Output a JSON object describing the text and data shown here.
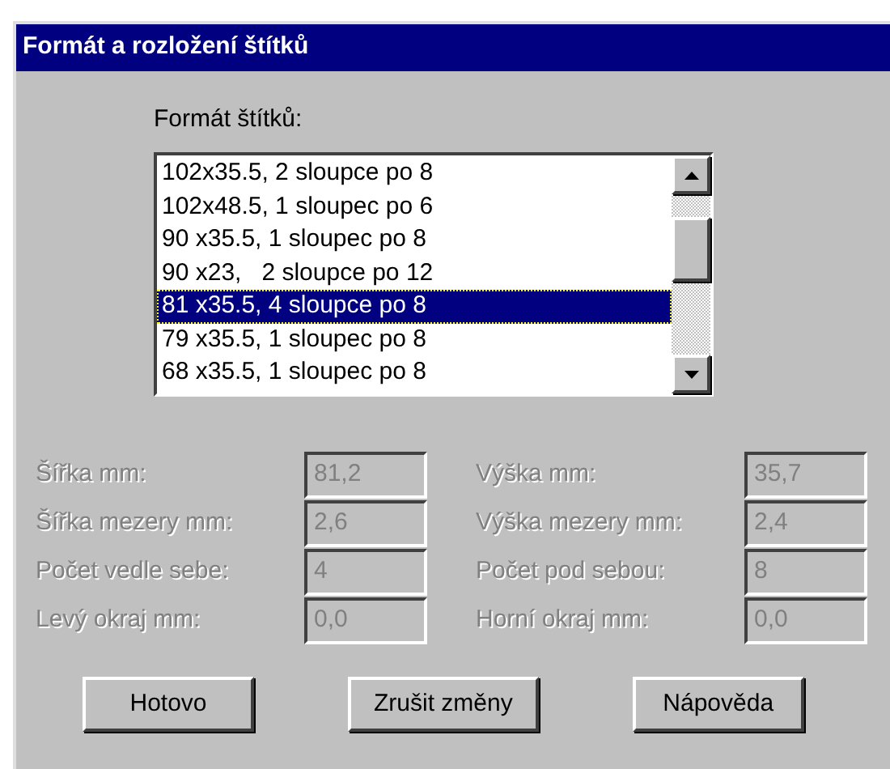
{
  "window": {
    "title": "Formát a rozložení štítků"
  },
  "format_list": {
    "label": "Formát štítků:",
    "items": [
      {
        "text": "102x35.5, 2 sloupce po 8",
        "selected": false
      },
      {
        "text": "102x48.5, 1 sloupec po 6",
        "selected": false
      },
      {
        "text": "90 x35.5, 1 sloupec po 8",
        "selected": false
      },
      {
        "text": "90 x23,   2 sloupce po 12",
        "selected": false
      },
      {
        "text": "81 x35.5, 4 sloupce po 8",
        "selected": true
      },
      {
        "text": "79 x35.5, 1 sloupec po 8",
        "selected": false
      },
      {
        "text": "68 x35.5, 1 sloupec po 8",
        "selected": false
      }
    ]
  },
  "fields": [
    {
      "label": "Šířka mm:",
      "value": "81,2",
      "disabled": true
    },
    {
      "label": "Výška mm:",
      "value": "35,7",
      "disabled": true
    },
    {
      "label": "Šířka mezery mm:",
      "value": "2,6",
      "disabled": true
    },
    {
      "label": "Výška mezery mm:",
      "value": "2,4",
      "disabled": true
    },
    {
      "label": "Počet vedle sebe:",
      "value": "4",
      "disabled": true
    },
    {
      "label": "Počet pod sebou:",
      "value": "8",
      "disabled": true
    },
    {
      "label": "Levý okraj mm:",
      "value": "0,0",
      "disabled": true
    },
    {
      "label": "Horní okraj mm:",
      "value": "0,0",
      "disabled": true
    }
  ],
  "buttons": [
    "Hotovo",
    "Zrušit změny",
    "Nápověda"
  ]
}
